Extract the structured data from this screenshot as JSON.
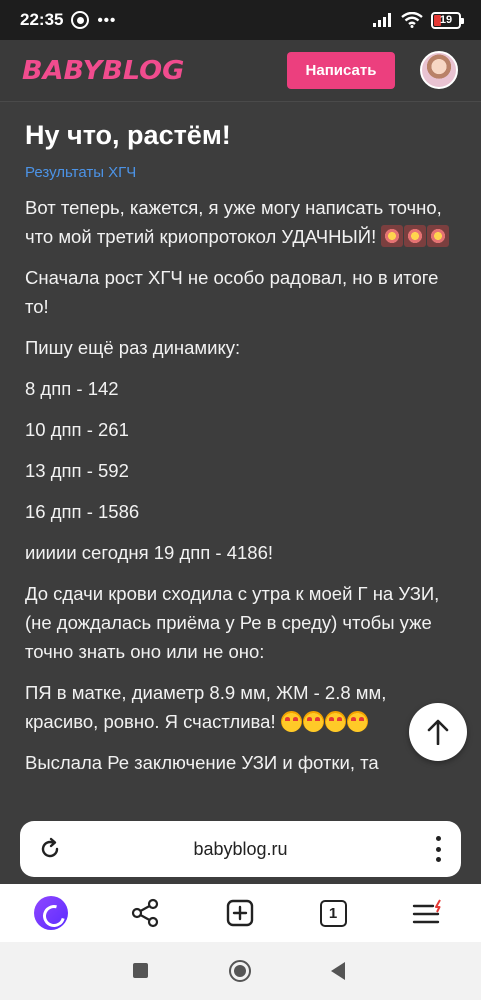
{
  "status": {
    "time": "22:35",
    "dots": "•••",
    "battery": "19"
  },
  "header": {
    "logo": "BABYBLOG",
    "write_button": "Написать"
  },
  "post": {
    "title": "Ну что, растём!",
    "tag": "Результаты ХГЧ",
    "paragraphs": {
      "p1": "Вот теперь, кажется, я уже могу написать точно, что мой третий криопротокол УДАЧНЫЙ!",
      "p2": "Сначала рост ХГЧ не особо радовал, но в итоге то!",
      "p3": "Пишу ещё раз динамику:",
      "p4": "8 дпп - 142",
      "p5": "10 дпп - 261",
      "p6": "13 дпп - 592",
      "p7": "16 дпп - 1586",
      "p8": "иииии сегодня 19 дпп - 4186!",
      "p9": "До сдачи крови сходила с утра к моей Г на УЗИ, (не дождалась приёма у Ре в среду) чтобы уже точно знать оно или не оно:",
      "p10": "ПЯ в матке, диаметр 8.9 мм, ЖМ - 2.8 мм, красиво, ровно. Я счастлива!",
      "p11": "Выслала Ре заключение УЗИ и фотки, та"
    }
  },
  "browser": {
    "url": "babyblog.ru",
    "tab_count": "1"
  },
  "colors": {
    "accent": "#ec3f7e",
    "logo": "#f14c8e",
    "link": "#4c93e6",
    "background": "#3d3d3d"
  },
  "icons": {
    "reload": "reload-icon",
    "menu": "more-vertical-icon",
    "alice": "alice-assistant-icon",
    "share": "share-icon",
    "new_tab": "plus-square-icon",
    "tabs": "tabs-count-icon",
    "hamburger": "menu-icon",
    "scroll_top": "arrow-up-icon"
  }
}
